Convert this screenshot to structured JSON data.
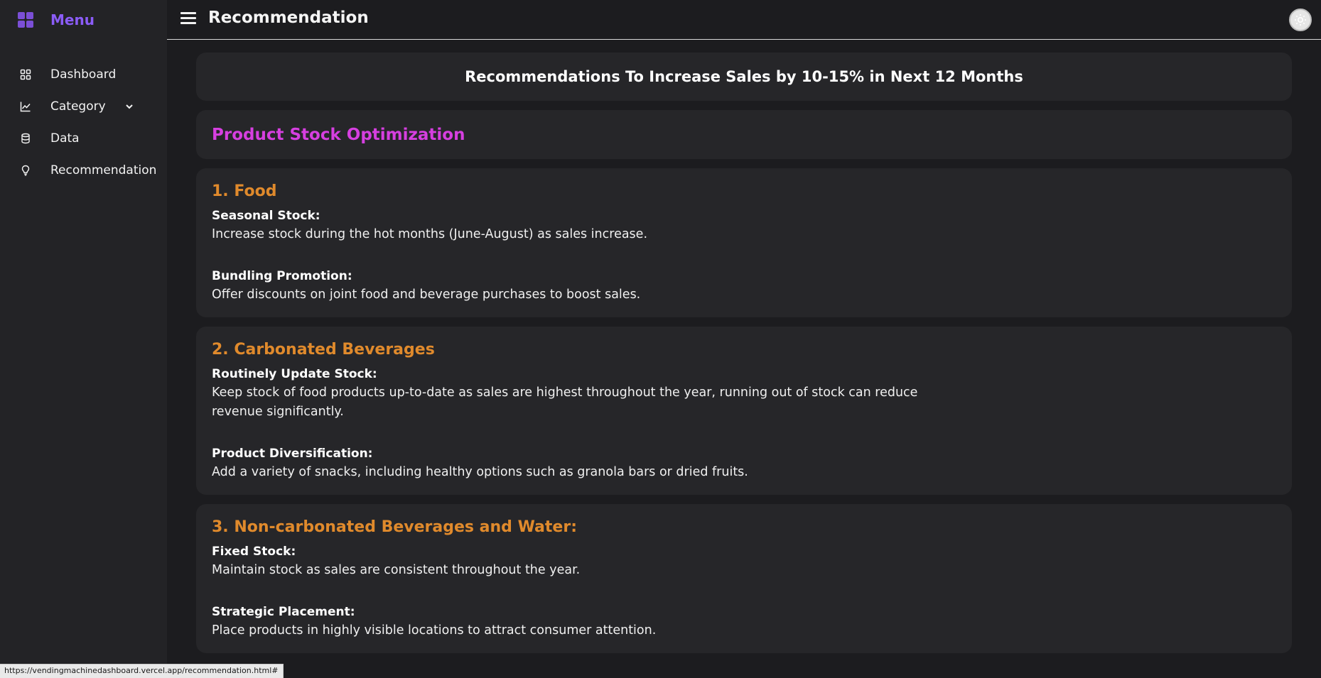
{
  "sidebar": {
    "title": "Menu",
    "items": [
      {
        "label": "Dashboard",
        "icon": "dashboard-grid-icon"
      },
      {
        "label": "Category",
        "icon": "line-chart-icon",
        "has_submenu": true
      },
      {
        "label": "Data",
        "icon": "database-icon"
      },
      {
        "label": "Recommendation",
        "icon": "lightbulb-icon"
      }
    ]
  },
  "header": {
    "title": "Recommendation"
  },
  "banner": {
    "title": "Recommendations To Increase Sales by 10-15% in Next 12 Months"
  },
  "section": {
    "title": "Product Stock Optimization"
  },
  "recommendations": [
    {
      "title": "1. Food",
      "points": [
        {
          "label": "Seasonal Stock:",
          "text": "Increase stock during the hot months (June-August) as sales increase."
        },
        {
          "label": "Bundling Promotion:",
          "text": "Offer discounts on joint food and beverage purchases to boost sales."
        }
      ]
    },
    {
      "title": "2. Carbonated Beverages",
      "points": [
        {
          "label": "Routinely Update Stock:",
          "text": "Keep stock of food products up-to-date as sales are highest throughout the year, running out of stock can reduce revenue significantly."
        },
        {
          "label": "Product Diversification:",
          "text": "Add a variety of snacks, including healthy options such as granola bars or dried fruits."
        }
      ]
    },
    {
      "title": "3. Non-carbonated Beverages and Water:",
      "points": [
        {
          "label": "Fixed Stock:",
          "text": "Maintain stock as sales are consistent throughout the year."
        },
        {
          "label": "Strategic Placement:",
          "text": "Place products in highly visible locations to attract consumer attention."
        }
      ]
    }
  ],
  "status_bar": {
    "url": "https://vendingmachinedashboard.vercel.app/recommendation.html#"
  },
  "colors": {
    "brand": "#8b5cf6",
    "section_heading": "#d63fe0",
    "card_heading": "#e08a2c",
    "background": "#1c1c1f",
    "card": "#262629"
  }
}
